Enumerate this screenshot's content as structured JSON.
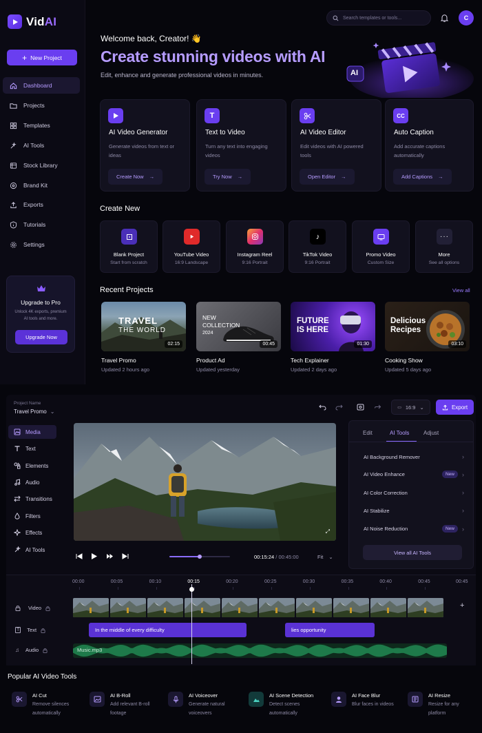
{
  "brand": {
    "name_prefix": "Vid",
    "name_suffix": "AI"
  },
  "sidebar": {
    "new_project": "New Project",
    "items": [
      {
        "label": "Dashboard",
        "icon": "home-icon"
      },
      {
        "label": "Projects",
        "icon": "folder-icon"
      },
      {
        "label": "Templates",
        "icon": "grid-icon"
      },
      {
        "label": "AI Tools",
        "icon": "sparkles-icon"
      },
      {
        "label": "Stock Library",
        "icon": "library-icon"
      },
      {
        "label": "Brand Kit",
        "icon": "palette-icon"
      },
      {
        "label": "Exports",
        "icon": "upload-icon"
      },
      {
        "label": "Tutorials",
        "icon": "info-icon"
      },
      {
        "label": "Settings",
        "icon": "gear-icon"
      }
    ],
    "upgrade": {
      "title": "Upgrade to Pro",
      "desc": "Unlock 4K exports, premium AI tools and more.",
      "button": "Upgrade Now"
    }
  },
  "header": {
    "search_placeholder": "Search templates or tools...",
    "avatar_initial": "C",
    "welcome": "Welcome back, Creator! 👋",
    "headline": "Create stunning videos with AI",
    "subline": "Edit, enhance and generate professional videos in minutes.",
    "hero_badge": "AI"
  },
  "features": [
    {
      "title": "AI Video Generator",
      "desc": "Generate videos from text or ideas",
      "button": "Create Now"
    },
    {
      "title": "Text to Video",
      "desc": "Turn any text into engaging videos",
      "button": "Try Now"
    },
    {
      "title": "AI Video Editor",
      "desc": "Edit videos with AI powered tools",
      "button": "Open Editor"
    },
    {
      "title": "Auto Caption",
      "desc": "Add accurate captions automatically",
      "button": "Add Captions"
    }
  ],
  "create_new": {
    "title": "Create New",
    "items": [
      {
        "name": "Blank Project",
        "sub": "Start from scratch"
      },
      {
        "name": "YouTube Video",
        "sub": "16:9 Landscape"
      },
      {
        "name": "Instagram Reel",
        "sub": "9:16 Portrait"
      },
      {
        "name": "TikTok Video",
        "sub": "9:16 Portrait"
      },
      {
        "name": "Promo Video",
        "sub": "Custom Size"
      },
      {
        "name": "More",
        "sub": "See all options"
      }
    ]
  },
  "recent": {
    "title": "Recent Projects",
    "view_all": "View all",
    "items": [
      {
        "name": "Travel Promo",
        "time": "Updated 2 hours ago",
        "duration": "02:15",
        "overlay": [
          "TRAVEL",
          "THE WORLD"
        ]
      },
      {
        "name": "Product Ad",
        "time": "Updated yesterday",
        "duration": "00:45",
        "overlay": [
          "NEW",
          "COLLECTION",
          "2024"
        ]
      },
      {
        "name": "Tech Explainer",
        "time": "Updated 2 days ago",
        "duration": "01:30",
        "overlay": [
          "FUTURE",
          "IS HERE"
        ]
      },
      {
        "name": "Cooking Show",
        "time": "Updated 5 days ago",
        "duration": "03:10",
        "overlay": [
          "Delicious",
          "Recipes"
        ]
      }
    ]
  },
  "editor": {
    "project_label": "Project Name",
    "project_name": "Travel Promo",
    "ratio": "16:9",
    "export": "Export",
    "tools": [
      "Media",
      "Text",
      "Elements",
      "Audio",
      "Transitions",
      "Filters",
      "Effects",
      "AI Tools"
    ],
    "player": {
      "current": "00:15:24",
      "total": "/ 00:45:00",
      "fit": "Fit",
      "progress": 0.5
    },
    "panel": {
      "tabs": [
        "Edit",
        "AI Tools",
        "Adjust"
      ],
      "active_tab": "AI Tools",
      "rows": [
        {
          "label": "AI Background Remover",
          "badge": ""
        },
        {
          "label": "AI Video Enhance",
          "badge": "New"
        },
        {
          "label": "AI Color Correction",
          "badge": ""
        },
        {
          "label": "AI Stabilize",
          "badge": ""
        },
        {
          "label": "AI Noise Reduction",
          "badge": "New"
        }
      ],
      "view_all": "View all AI Tools"
    },
    "timeline": {
      "ticks": [
        "00:00",
        "00:05",
        "00:10",
        "00:15",
        "00:20",
        "00:25",
        "00:30",
        "00:35",
        "00:40",
        "00:45",
        "00:45"
      ],
      "tracks": [
        "Video",
        "Text",
        "Audio"
      ],
      "text_clips": [
        "In the middle of every difficulty",
        "lies opportunity"
      ],
      "audio_clip": "Music.mp3"
    }
  },
  "popular": {
    "title": "Popular AI Video Tools",
    "items": [
      {
        "name": "AI Cut",
        "desc": "Remove silences automatically"
      },
      {
        "name": "AI B-Roll",
        "desc": "Add relevant B-roll footage"
      },
      {
        "name": "AI Voiceover",
        "desc": "Generate natural voiceovers"
      },
      {
        "name": "AI Scene Detection",
        "desc": "Detect scenes automatically"
      },
      {
        "name": "AI Face Blur",
        "desc": "Blur faces in videos"
      },
      {
        "name": "AI Resize",
        "desc": "Resize for any platform"
      }
    ]
  },
  "colors": {
    "accent": "#6a3ef0",
    "accent_light": "#b69cff",
    "background": "#06060c",
    "card": "#12111e"
  }
}
